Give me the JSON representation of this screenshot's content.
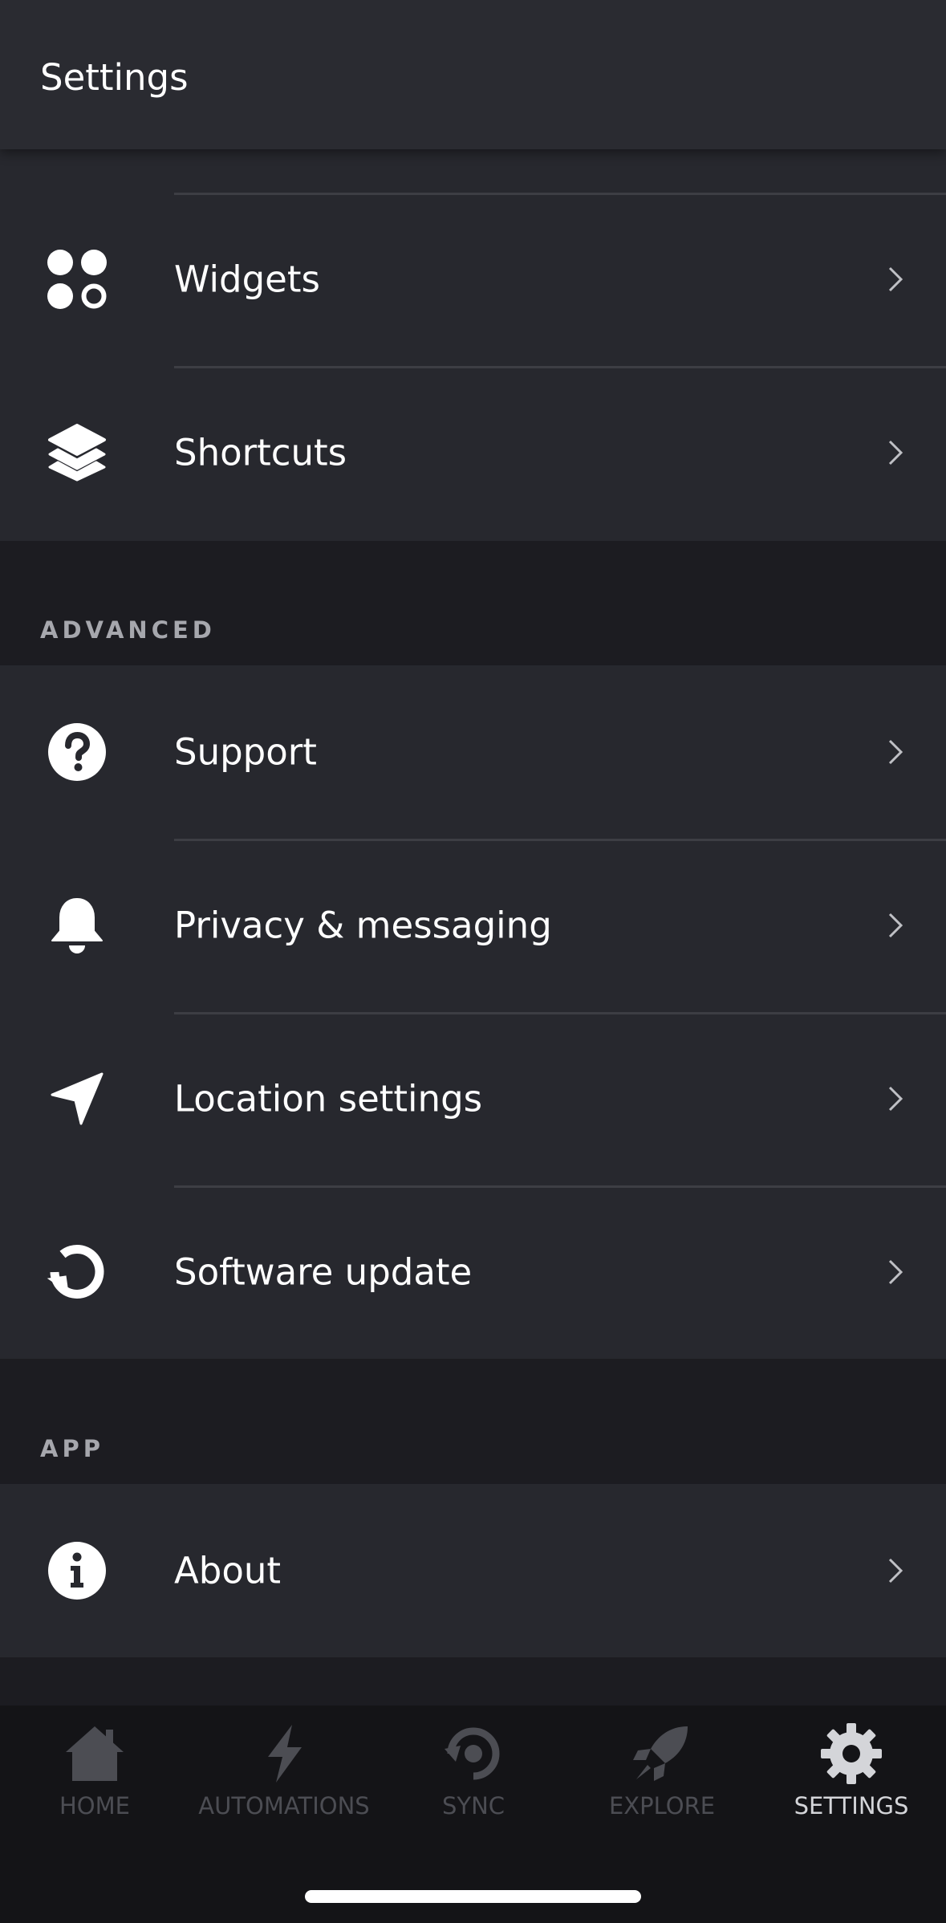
{
  "header": {
    "title": "Settings"
  },
  "groups": {
    "top": {
      "items": [
        {
          "label": "Widgets",
          "icon": "widgets-icon"
        },
        {
          "label": "Shortcuts",
          "icon": "layers-icon"
        }
      ]
    },
    "advanced": {
      "title": "ADVANCED",
      "items": [
        {
          "label": "Support",
          "icon": "question-icon"
        },
        {
          "label": "Privacy & messaging",
          "icon": "bell-icon"
        },
        {
          "label": "Location settings",
          "icon": "location-arrow-icon"
        },
        {
          "label": "Software update",
          "icon": "refresh-icon"
        }
      ]
    },
    "app": {
      "title": "APP",
      "items": [
        {
          "label": "About",
          "icon": "info-icon"
        }
      ]
    }
  },
  "tabbar": {
    "tabs": [
      {
        "label": "HOME",
        "icon": "home-icon",
        "active": false
      },
      {
        "label": "AUTOMATIONS",
        "icon": "bolt-icon",
        "active": false
      },
      {
        "label": "SYNC",
        "icon": "sync-icon",
        "active": false
      },
      {
        "label": "EXPLORE",
        "icon": "rocket-icon",
        "active": false
      },
      {
        "label": "SETTINGS",
        "icon": "gear-icon",
        "active": true
      }
    ]
  },
  "colors": {
    "background": "#1c1c21",
    "card": "#27282e",
    "header": "#2a2b31",
    "tabbar": "#141417",
    "inactive_tab": "#4c4d53",
    "active_tab": "#d4d5d9"
  }
}
